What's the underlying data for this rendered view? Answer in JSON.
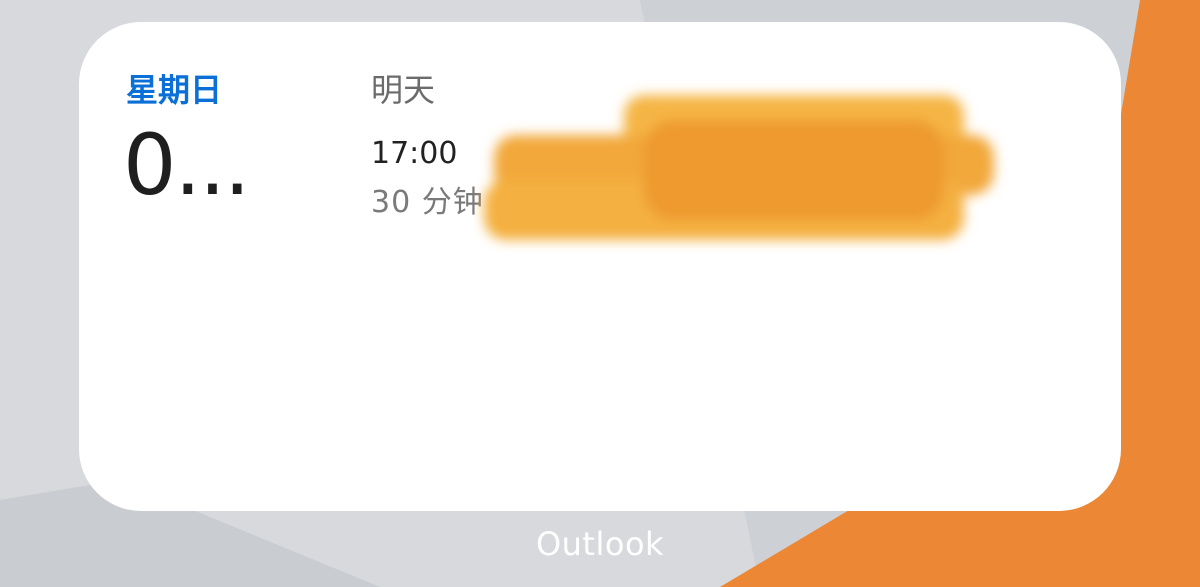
{
  "widget": {
    "today": {
      "day_name": "星期日",
      "day_number": "0..."
    },
    "upcoming": {
      "label": "明天",
      "event": {
        "time": "17:00",
        "duration": "30 分钟"
      }
    }
  },
  "app_label": "Outlook",
  "colors": {
    "accent_blue": "#0a6fd6",
    "wallpaper_orange": "#ec8735",
    "wallpaper_gray": "#d7d9dc",
    "redaction_yellow": "#f2a83a"
  }
}
